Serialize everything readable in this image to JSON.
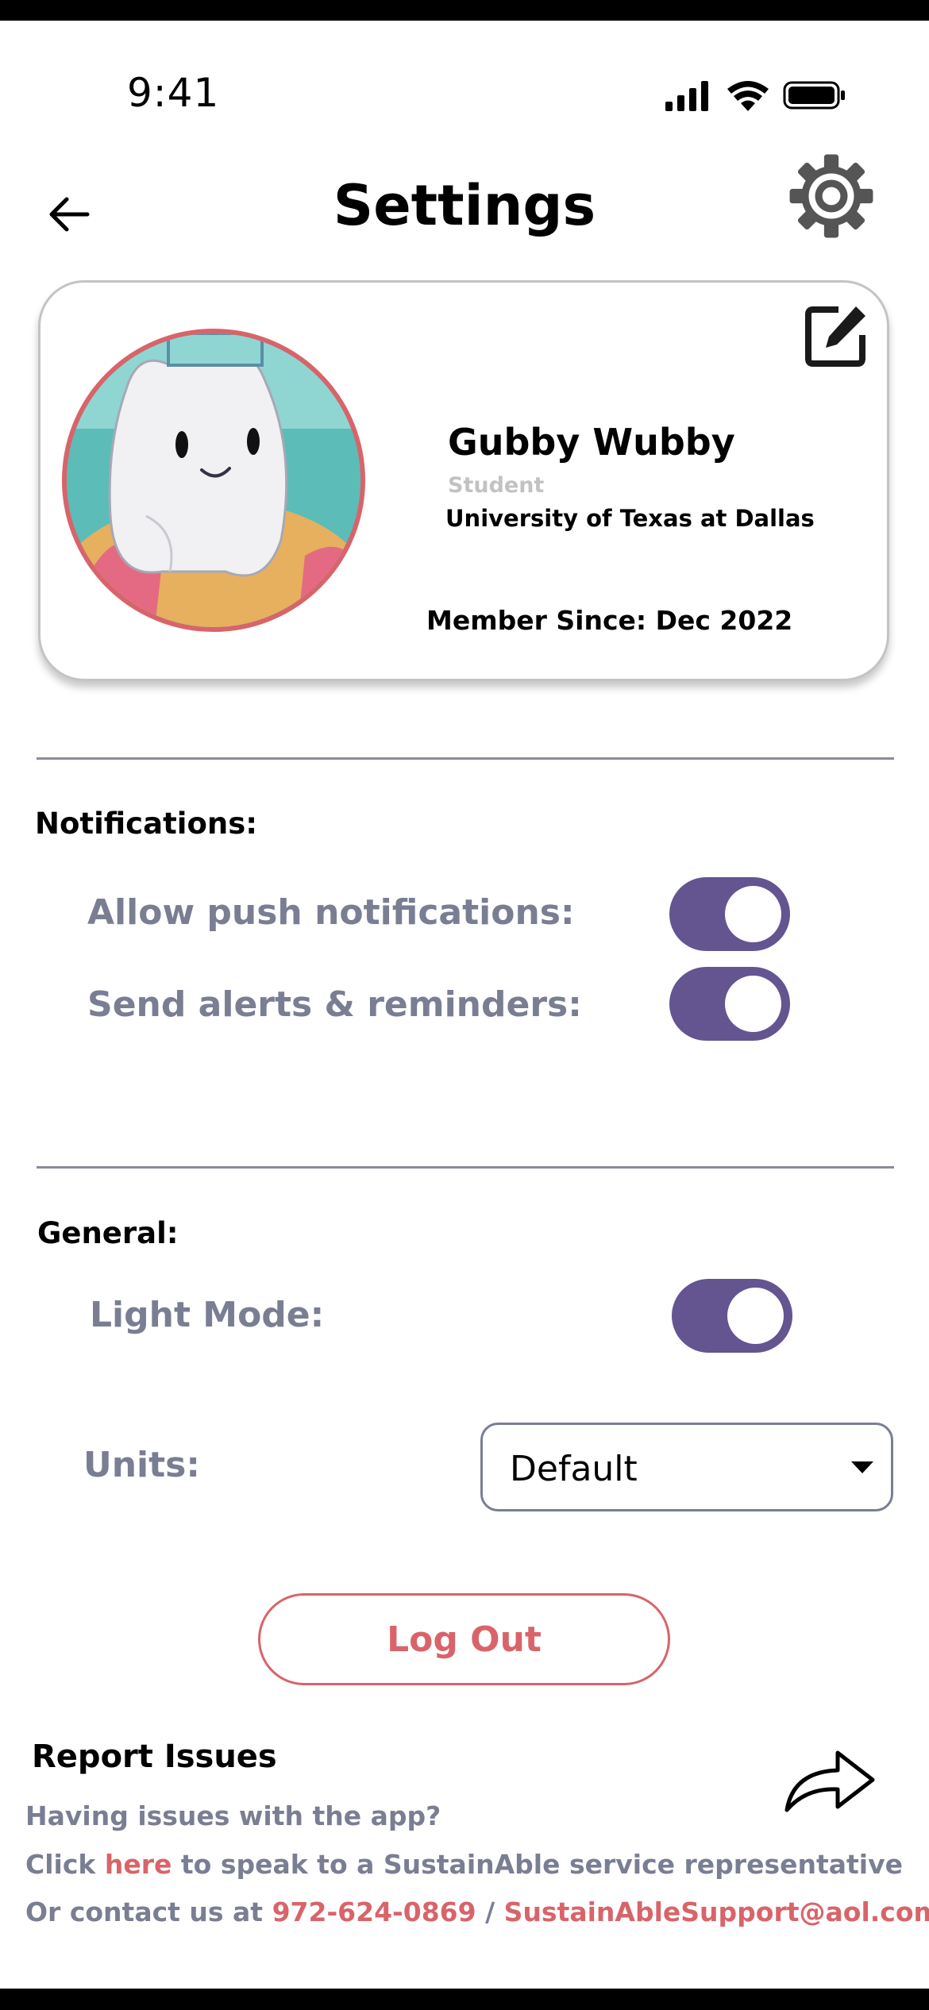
{
  "status_bar": {
    "time": "9:41"
  },
  "header": {
    "title": "Settings"
  },
  "profile": {
    "name": "Gubby Wubby",
    "role": "Student",
    "university": "University of Texas at Dallas",
    "member_since": "Member Since: Dec 2022"
  },
  "notifications": {
    "title": "Notifications:",
    "push_label": "Allow push notifications:",
    "push_enabled": true,
    "alerts_label": "Send alerts & reminders:",
    "alerts_enabled": true
  },
  "general": {
    "title": "General:",
    "light_mode_label": "Light Mode:",
    "light_mode_enabled": true,
    "units_label": "Units:",
    "units_value": "Default"
  },
  "logout_label": "Log Out",
  "report": {
    "title": "Report Issues",
    "line1": "Having issues with the app?",
    "click_prefix": "Click",
    "here_link": "here",
    "click_suffix": "to speak to a SustainAble service representative",
    "contact_prefix": "Or contact us at",
    "phone": "972-624-0869",
    "separator": "/",
    "email": "SustainAbleSupport@aol.com"
  },
  "colors": {
    "accent_purple": "#645490",
    "accent_red": "#d8646a",
    "muted_text": "#7a7e93"
  }
}
